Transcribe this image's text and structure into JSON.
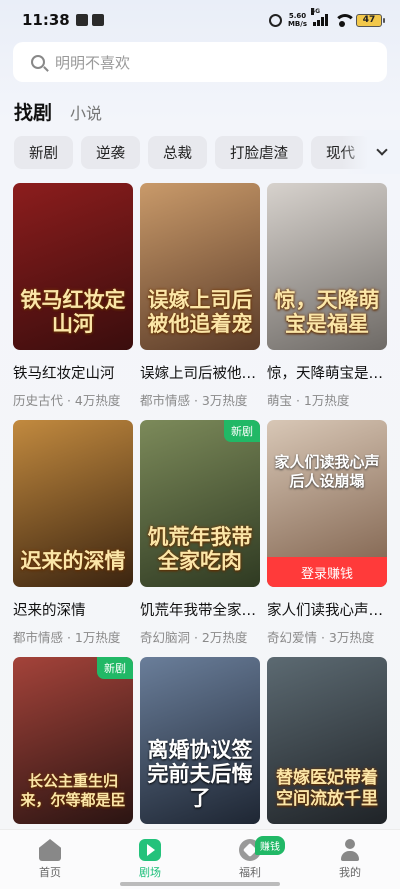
{
  "status_bar": {
    "time": "11:38",
    "net_speed_value": "5.60",
    "net_speed_unit": "MB/s",
    "network_type": "5G",
    "battery": "47"
  },
  "search": {
    "placeholder": "明明不喜欢"
  },
  "tabs": [
    {
      "label": "找剧",
      "active": true
    },
    {
      "label": "小说",
      "active": false
    }
  ],
  "chips": [
    "新剧",
    "逆袭",
    "总裁",
    "打脸虐渣",
    "现代"
  ],
  "dramas": [
    {
      "poster_text": "铁马红妆定山河",
      "title": "铁马红妆定山河",
      "meta": "历史古代 · 4万热度",
      "colors": [
        "#8c1d1d",
        "#3a0d0d"
      ],
      "badge": "",
      "cta": ""
    },
    {
      "poster_text": "误嫁上司后被他追着宠",
      "title": "误嫁上司后被他追着宠",
      "meta": "都市情感 · 3万热度",
      "colors": [
        "#c99a6a",
        "#5a3b28"
      ],
      "badge": "",
      "cta": ""
    },
    {
      "poster_text": "惊，天降萌宝是福星",
      "title": "惊，天降萌宝是福星",
      "meta": "萌宝 · 1万热度",
      "colors": [
        "#d7d2cd",
        "#6e6a66"
      ],
      "badge": "",
      "cta": ""
    },
    {
      "poster_text": "迟来的深情",
      "title": "迟来的深情",
      "meta": "都市情感 · 1万热度",
      "colors": [
        "#c28a3f",
        "#3b2410"
      ],
      "badge": "",
      "cta": ""
    },
    {
      "poster_text": "饥荒年我带全家吃肉",
      "title": "饥荒年我带全家吃肉",
      "meta": "奇幻脑洞 · 2万热度",
      "colors": [
        "#7c8a5a",
        "#2f3a22"
      ],
      "badge": "新剧",
      "cta": ""
    },
    {
      "poster_text": "家人们读我心声后人设崩塌",
      "title": "家人们读我心声后人设崩塌",
      "meta": "奇幻爱情 · 3万热度",
      "colors": [
        "#d8c7b6",
        "#7b5d48"
      ],
      "badge": "",
      "cta": "登录赚钱"
    },
    {
      "poster_text": "长公主重生归来，尔等都是臣",
      "title": "",
      "meta": "",
      "colors": [
        "#a4433a",
        "#2a1412"
      ],
      "badge": "新剧",
      "cta": ""
    },
    {
      "poster_text": "离婚协议签完前夫后悔了",
      "title": "",
      "meta": "",
      "colors": [
        "#6a7e9a",
        "#1e2633"
      ],
      "badge": "",
      "cta": ""
    },
    {
      "poster_text": "替嫁医妃带着空间流放千里",
      "title": "",
      "meta": "",
      "colors": [
        "#5c6a72",
        "#1f2327"
      ],
      "badge": "",
      "cta": ""
    }
  ],
  "bottom_nav": [
    {
      "label": "首页",
      "icon": "home-icon",
      "active": false
    },
    {
      "label": "剧场",
      "icon": "theater-play-icon",
      "active": true
    },
    {
      "label": "福利",
      "icon": "welfare-icon",
      "active": false,
      "badge": "赚钱"
    },
    {
      "label": "我的",
      "icon": "profile-icon",
      "active": false
    }
  ]
}
